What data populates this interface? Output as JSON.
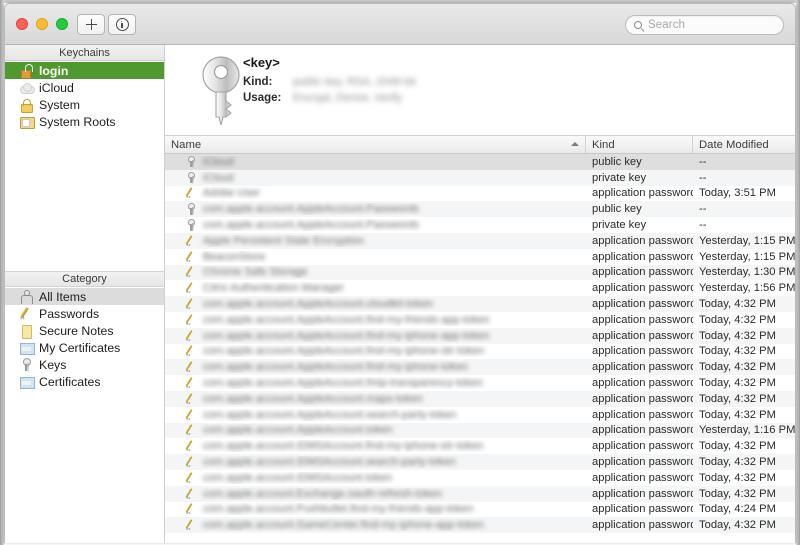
{
  "window": {
    "traffic_lights": [
      "close",
      "minimize",
      "zoom"
    ],
    "colors": {
      "close": "#ff5f57",
      "minimize": "#ffbd2e",
      "zoom": "#28c840",
      "selection_green": "#4e9a2f",
      "selection_gray": "#dcdcdc",
      "row_stripe": "#f4f5f6"
    }
  },
  "toolbar": {
    "add_label": "+",
    "add_icon": "plus-icon",
    "info_icon": "info-circle-icon"
  },
  "search": {
    "icon": "search-icon",
    "placeholder": "Search",
    "value": ""
  },
  "sidebar": {
    "keychains_header": "Keychains",
    "keychains": [
      {
        "label": "login",
        "icon": "keychain-unlocked-icon",
        "selected": true
      },
      {
        "label": "iCloud",
        "icon": "cloud-icon",
        "selected": false
      },
      {
        "label": "System",
        "icon": "lock-icon",
        "selected": false
      },
      {
        "label": "System Roots",
        "icon": "certificate-folder-icon",
        "selected": false
      }
    ],
    "category_header": "Category",
    "categories": [
      {
        "label": "All Items",
        "icon": "all-items-icon",
        "selected": true
      },
      {
        "label": "Passwords",
        "icon": "pencil-icon",
        "selected": false
      },
      {
        "label": "Secure Notes",
        "icon": "secure-note-icon",
        "selected": false
      },
      {
        "label": "My Certificates",
        "icon": "certificate-icon",
        "selected": false
      },
      {
        "label": "Keys",
        "icon": "key-icon",
        "selected": false
      },
      {
        "label": "Certificates",
        "icon": "certificate-icon",
        "selected": false
      }
    ]
  },
  "detail": {
    "icon": "large-key-icon",
    "name": "<key>",
    "kind_label": "Kind:",
    "kind_value_redacted": "public key, RSA, 2048-bit",
    "usage_label": "Usage:",
    "usage_value_redacted": "Encrypt, Derive, Verify"
  },
  "table": {
    "columns": [
      {
        "key": "name",
        "label": "Name",
        "sorted": true,
        "sort_direction": "ascending"
      },
      {
        "key": "kind",
        "label": "Kind",
        "sorted": false
      },
      {
        "key": "date",
        "label": "Date Modified",
        "sorted": false
      }
    ],
    "rows": [
      {
        "icon": "key-icon",
        "name_redacted": "iCloud",
        "kind": "public key",
        "date": "--"
      },
      {
        "icon": "key-icon",
        "name_redacted": "iCloud",
        "kind": "private key",
        "date": "--"
      },
      {
        "icon": "pencil-icon",
        "name_redacted": "Adobe User",
        "kind": "application password",
        "date": "Today, 3:51 PM"
      },
      {
        "icon": "key-icon",
        "name_redacted": "com.apple.account.AppleAccount.Passwords",
        "kind": "public key",
        "date": "--"
      },
      {
        "icon": "key-icon",
        "name_redacted": "com.apple.account.AppleAccount.Passwords",
        "kind": "private key",
        "date": "--"
      },
      {
        "icon": "pencil-icon",
        "name_redacted": "Apple Persistent State Encryption",
        "kind": "application password",
        "date": "Yesterday, 1:15 PM"
      },
      {
        "icon": "pencil-icon",
        "name_redacted": "BeaconStore",
        "kind": "application password",
        "date": "Yesterday, 1:15 PM"
      },
      {
        "icon": "pencil-icon",
        "name_redacted": "Chrome Safe Storage",
        "kind": "application password",
        "date": "Yesterday, 1:30 PM"
      },
      {
        "icon": "pencil-icon",
        "name_redacted": "Citrix Authentication Manager",
        "kind": "application password",
        "date": "Yesterday, 1:56 PM"
      },
      {
        "icon": "pencil-icon",
        "name_redacted": "com.apple.account.AppleAccount.cloudkit-token",
        "kind": "application password",
        "date": "Today, 4:32 PM"
      },
      {
        "icon": "pencil-icon",
        "name_redacted": "com.apple.account.AppleAccount.find-my-friends-app-token",
        "kind": "application password",
        "date": "Today, 4:32 PM"
      },
      {
        "icon": "pencil-icon",
        "name_redacted": "com.apple.account.AppleAccount.find-my-iphone-app-token",
        "kind": "application password",
        "date": "Today, 4:32 PM"
      },
      {
        "icon": "pencil-icon",
        "name_redacted": "com.apple.account.AppleAccount.find-my-iphone-otr-token",
        "kind": "application password",
        "date": "Today, 4:32 PM"
      },
      {
        "icon": "pencil-icon",
        "name_redacted": "com.apple.account.AppleAccount.find-my-iphone-token",
        "kind": "application password",
        "date": "Today, 4:32 PM"
      },
      {
        "icon": "pencil-icon",
        "name_redacted": "com.apple.account.AppleAccount.fmip-transparency-token",
        "kind": "application password",
        "date": "Today, 4:32 PM"
      },
      {
        "icon": "pencil-icon",
        "name_redacted": "com.apple.account.AppleAccount.maps-token",
        "kind": "application password",
        "date": "Today, 4:32 PM"
      },
      {
        "icon": "pencil-icon",
        "name_redacted": "com.apple.account.AppleAccount.search-party-token",
        "kind": "application password",
        "date": "Today, 4:32 PM"
      },
      {
        "icon": "pencil-icon",
        "name_redacted": "com.apple.account.AppleAccount.token",
        "kind": "application password",
        "date": "Yesterday, 1:16 PM"
      },
      {
        "icon": "pencil-icon",
        "name_redacted": "com.apple.account.IDMSAccount.find-my-iphone-otr-token",
        "kind": "application password",
        "date": "Today, 4:32 PM"
      },
      {
        "icon": "pencil-icon",
        "name_redacted": "com.apple.account.IDMSAccount.search-party-token",
        "kind": "application password",
        "date": "Today, 4:32 PM"
      },
      {
        "icon": "pencil-icon",
        "name_redacted": "com.apple.account.IDMSAccount.token",
        "kind": "application password",
        "date": "Today, 4:32 PM"
      },
      {
        "icon": "pencil-icon",
        "name_redacted": "com.apple.account.Exchange.oauth-refresh-token",
        "kind": "application password",
        "date": "Today, 4:32 PM"
      },
      {
        "icon": "pencil-icon",
        "name_redacted": "com.apple.account.Pushbullet.find-my-friends-app-token",
        "kind": "application password",
        "date": "Today, 4:24 PM"
      },
      {
        "icon": "pencil-icon",
        "name_redacted": "com.apple.account.GameCenter.find-my-iphone-app-token",
        "kind": "application password",
        "date": "Today, 4:32 PM"
      }
    ]
  }
}
